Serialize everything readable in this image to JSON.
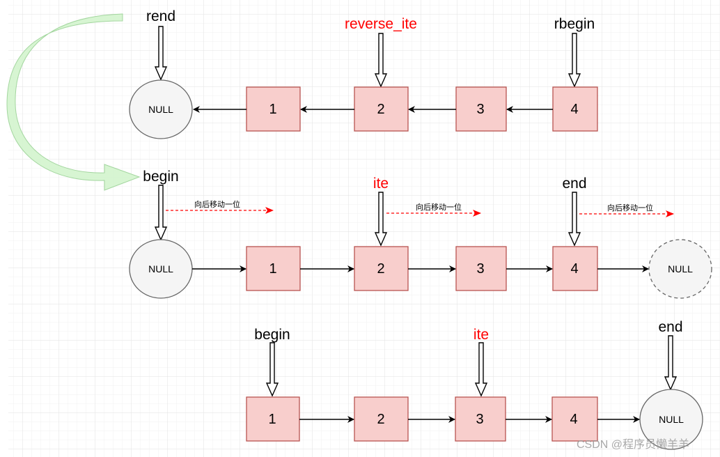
{
  "colors": {
    "node_fill": "#f8cecc",
    "node_stroke": "#b85450",
    "null_fill": "#f5f5f5",
    "highlight_label": "#ff0000",
    "move_arrow": "#ff0000",
    "curve_arrow": "#d5f5d0"
  },
  "row1": {
    "labels": {
      "rend": "rend",
      "reverse_ite": "reverse_ite",
      "rbegin": "rbegin"
    },
    "null": "NULL",
    "nodes": [
      "1",
      "2",
      "3",
      "4"
    ]
  },
  "row2": {
    "labels": {
      "begin": "begin",
      "ite": "ite",
      "end": "end"
    },
    "null_start": "NULL",
    "null_end": "NULL",
    "nodes": [
      "1",
      "2",
      "3",
      "4"
    ],
    "move_text": "向后移动一位"
  },
  "row3": {
    "labels": {
      "begin": "begin",
      "ite": "ite",
      "end": "end"
    },
    "null": "NULL",
    "nodes": [
      "1",
      "2",
      "3",
      "4"
    ]
  },
  "watermark": "CSDN @程序员懒羊羊"
}
